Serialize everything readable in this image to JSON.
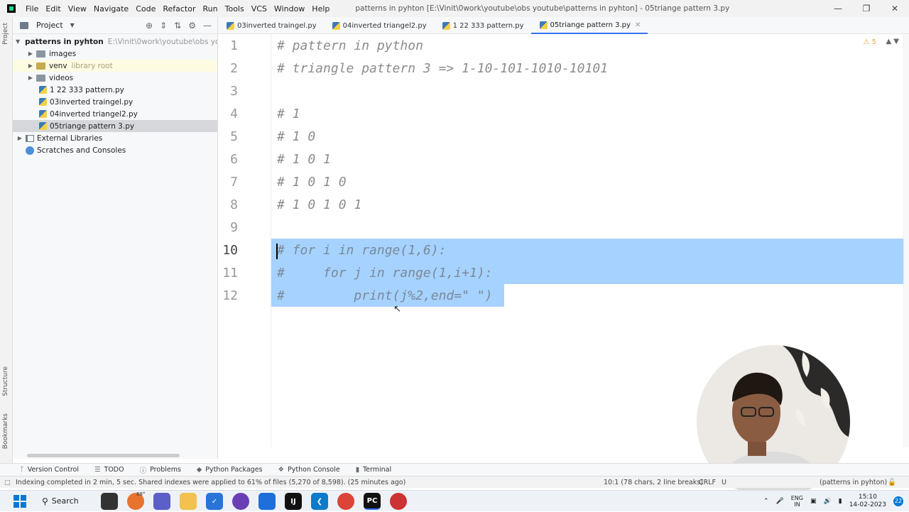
{
  "menu": [
    "File",
    "Edit",
    "View",
    "Navigate",
    "Code",
    "Refactor",
    "Run",
    "Tools",
    "VCS",
    "Window",
    "Help"
  ],
  "window_title": "patterns in pyhton [E:\\Vinit\\0work\\youtube\\obs youtube\\patterns in pyhton] - 05triange pattern 3.py",
  "side_labels": {
    "project": "Project",
    "structure": "Structure",
    "bookmarks": "Bookmarks"
  },
  "project": {
    "header": "Project",
    "root_name": "patterns in pyhton",
    "root_path": "E:\\Vinit\\0work\\youtube\\obs youtube",
    "items": [
      {
        "label": "images",
        "kind": "folder"
      },
      {
        "label": "venv",
        "kind": "folder",
        "extra": "library root"
      },
      {
        "label": "videos",
        "kind": "folder"
      },
      {
        "label": "1 22 333 pattern.py",
        "kind": "py"
      },
      {
        "label": "03inverted traingel.py",
        "kind": "py"
      },
      {
        "label": "04inverted triangel2.py",
        "kind": "py"
      },
      {
        "label": "05triange pattern 3.py",
        "kind": "py",
        "selected": true
      }
    ],
    "external": "External Libraries",
    "scratches": "Scratches and Consoles"
  },
  "tabs": [
    {
      "label": "03inverted traingel.py"
    },
    {
      "label": "04inverted triangel2.py"
    },
    {
      "label": "1 22 333 pattern.py"
    },
    {
      "label": "05triange pattern 3.py",
      "active": true
    }
  ],
  "editor": {
    "warning_count": "5",
    "lines": [
      {
        "n": "1",
        "text": "# pattern in python"
      },
      {
        "n": "2",
        "text": "# triangle pattern 3 => 1-10-101-1010-10101"
      },
      {
        "n": "3",
        "text": ""
      },
      {
        "n": "4",
        "text": "# 1"
      },
      {
        "n": "5",
        "text": "# 1 0"
      },
      {
        "n": "6",
        "text": "# 1 0 1"
      },
      {
        "n": "7",
        "text": "# 1 0 1 0"
      },
      {
        "n": "8",
        "text": "# 1 0 1 0 1"
      },
      {
        "n": "9",
        "text": ""
      },
      {
        "n": "10",
        "text": "# for i in range(1,6):",
        "selected": true
      },
      {
        "n": "11",
        "text": "#     for j in range(1,i+1):",
        "selected": true
      },
      {
        "n": "12",
        "text": "#         print(j%2,end=\" \")",
        "selected": true
      }
    ]
  },
  "bottom_tools": [
    "Version Control",
    "TODO",
    "Problems",
    "Python Packages",
    "Python Console",
    "Terminal"
  ],
  "status": {
    "message": "Indexing completed in 2 min, 5 sec. Shared indexes were applied to 61% of files (5,270 of 8,598). (25 minutes ago)",
    "position": "10:1 (78 chars, 2 line breaks)",
    "line_ending": "CRLF",
    "encoding": "U",
    "project": "(patterns in pyhton)"
  },
  "taskbar": {
    "search": "Search",
    "temperature": "88°",
    "language": [
      "ENG",
      "IN"
    ],
    "time": "15:10",
    "date": "14-02-2023",
    "notifications": "22"
  },
  "colors": {
    "selection": "#a6d2ff",
    "accent": "#3574f0",
    "comment": "#8c8c8c"
  }
}
